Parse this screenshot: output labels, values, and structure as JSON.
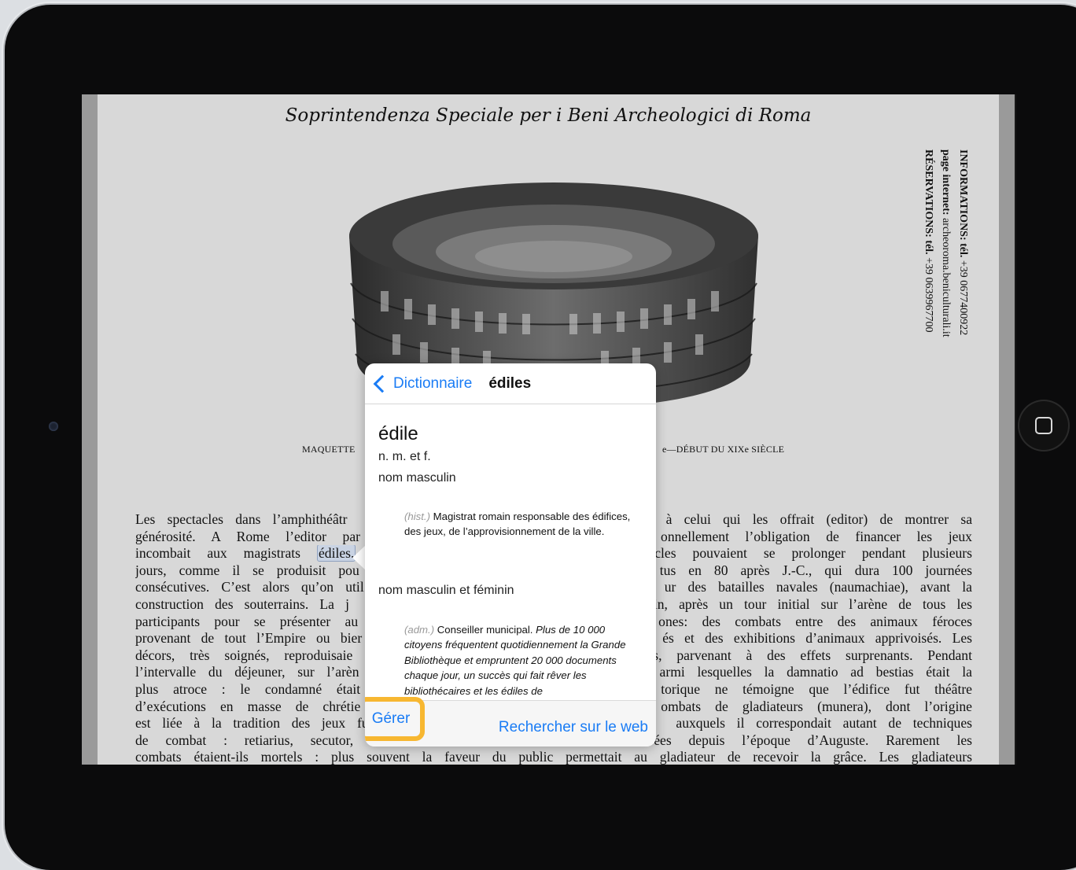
{
  "book": {
    "header": "Soprintendenza  Speciale per i Beni Archeologici di Roma",
    "info_lines": [
      {
        "label": "INFORMATIONS: tél.",
        "value": "+39 0677400922"
      },
      {
        "label": "page internet:",
        "value": "archeoroma.beniculturali.it"
      },
      {
        "label": "RÉSERVATIONS: tél.",
        "value": "+39 0639967700"
      }
    ],
    "caption_left": "MAQUETTE",
    "caption_right": "e—DÉBUT DU XIXe SIÈCLE",
    "paragraph_lines": [
      {
        "left": "Les spectacles dans l’amphithéâtr",
        "right": "é à celui qui les offrait (editor) de montrer sa"
      },
      {
        "left": "générosité. A Rome l’editor par",
        "right": "onnellement l’obligation de financer les jeux"
      },
      {
        "left": "incombait aux magistrats",
        "highlight": "édiles.",
        "right": "acles pouvaient se prolonger pendant plusieurs"
      },
      {
        "left": "jours, comme il se produisit pou",
        "right": "tus en 80 après J.-C., qui dura 100 journées"
      },
      {
        "left": "consécutives. C’est alors qu’on util",
        "right": "ur des batailles navales (naumachiae), avant la"
      },
      {
        "left": "construction des souterrains. La j",
        "right": "tin, après un tour initial sur l’arène de tous les"
      },
      {
        "left": "participants pour se présenter au",
        "right": "ones: des combats entre des animaux féroces"
      },
      {
        "left": "provenant de tout l’Empire ou bier",
        "right": "és et des exhibitions d’animaux apprivoisés. Les"
      },
      {
        "left": "décors, très soignés, reproduisaie",
        "right": "s, parvenant à des effets surprenants. Pendant"
      },
      {
        "left": "l’intervalle du déjeuner, sur l’arèn",
        "right": "armi lesquelles la damnatio ad bestias était la"
      },
      {
        "left": "plus atroce : le condamné était",
        "right": "torique ne témoigne que l’édifice fut théâtre"
      },
      {
        "left": "d’exécutions en masse de chrétie",
        "right": "ombats de gladiateurs (munera), dont l’origine"
      },
      {
        "left": "est liée à la tradition des jeux fun",
        "right": "auxquels il correspondait autant de techniques"
      },
      {
        "left": "de combat : retiarius, secutor,",
        "right": "ées depuis l’époque d’Auguste. Rarement les"
      },
      {
        "left": "combats étaient-ils mortels : plus souvent la faveur du public permettait au gladiateur de recevoir la grâce. Les gladiateurs",
        "right": ""
      }
    ]
  },
  "dictionary_popover": {
    "back_label": "Dictionnaire",
    "title": "édiles",
    "headword": "édile",
    "grammar": "n. m. et f.",
    "section1": "nom masculin",
    "def1_tag": "(hist.)",
    "def1_text": "Magistrat romain responsable des édifices, des jeux, de l’approvisionnement de la ville.",
    "section2": "nom masculin et féminin",
    "def2_tag": "(adm.)",
    "def2_text": "Conseiller municipal.",
    "def2_example": "Plus de 10 000 citoyens fréquentent quotidiennement la Grande Bibliothèque et empruntent 20 000 documents chaque jour, un succès qui fait rêver les bibliothécaires et les édiles de",
    "manage_label": "Gérer",
    "search_web_label": "Rechercher sur le web"
  },
  "colors": {
    "accent": "#1a7cf5",
    "highlight_ring": "#f7b731"
  }
}
